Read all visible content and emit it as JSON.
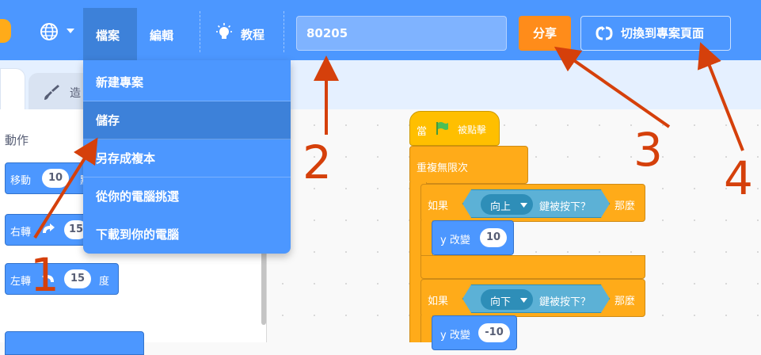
{
  "menubar": {
    "file_label": "檔案",
    "edit_label": "編輯",
    "tutorials_label": "教程",
    "project_title_value": "80205",
    "share_label": "分享",
    "see_project_label": "切換到專案頁面"
  },
  "file_menu": {
    "items": [
      "新建專案",
      "儲存",
      "另存成複本",
      "從你的電腦挑選",
      "下載到你的電腦"
    ],
    "highlighted_item": "儲存"
  },
  "tabs": {
    "costumes_partial": "造"
  },
  "palette": {
    "category_title": "動作",
    "move_label": "移動",
    "move_value": "10",
    "move_tail": "點",
    "turn_right_label": "右轉",
    "turn_right_value": "15",
    "turn_left_label": "左轉",
    "turn_left_value": "15",
    "turn_left_tail": "度"
  },
  "script": {
    "hat_label": "當",
    "hat_tail": "被點擊",
    "forever_label": "重複無限次",
    "if1_label": "如果",
    "if1_key": "向上",
    "if1_sense": "鍵被按下？",
    "if1_then": "那麼",
    "change_y_label": "y 改變",
    "change_y_value1": "10",
    "if2_label": "如果",
    "if2_key": "向下",
    "if2_sense": "鍵被按下？",
    "if2_then": "那麼",
    "change_y_value2": "-10"
  },
  "annotations": {
    "n1": "1",
    "n2": "2",
    "n3": "3",
    "n4": "4"
  },
  "colors": {
    "menubar": "#4c97ff",
    "share": "#ff8c1a",
    "annotation": "#d5400b",
    "control": "#ffab19",
    "sensing": "#5cb1d6"
  }
}
